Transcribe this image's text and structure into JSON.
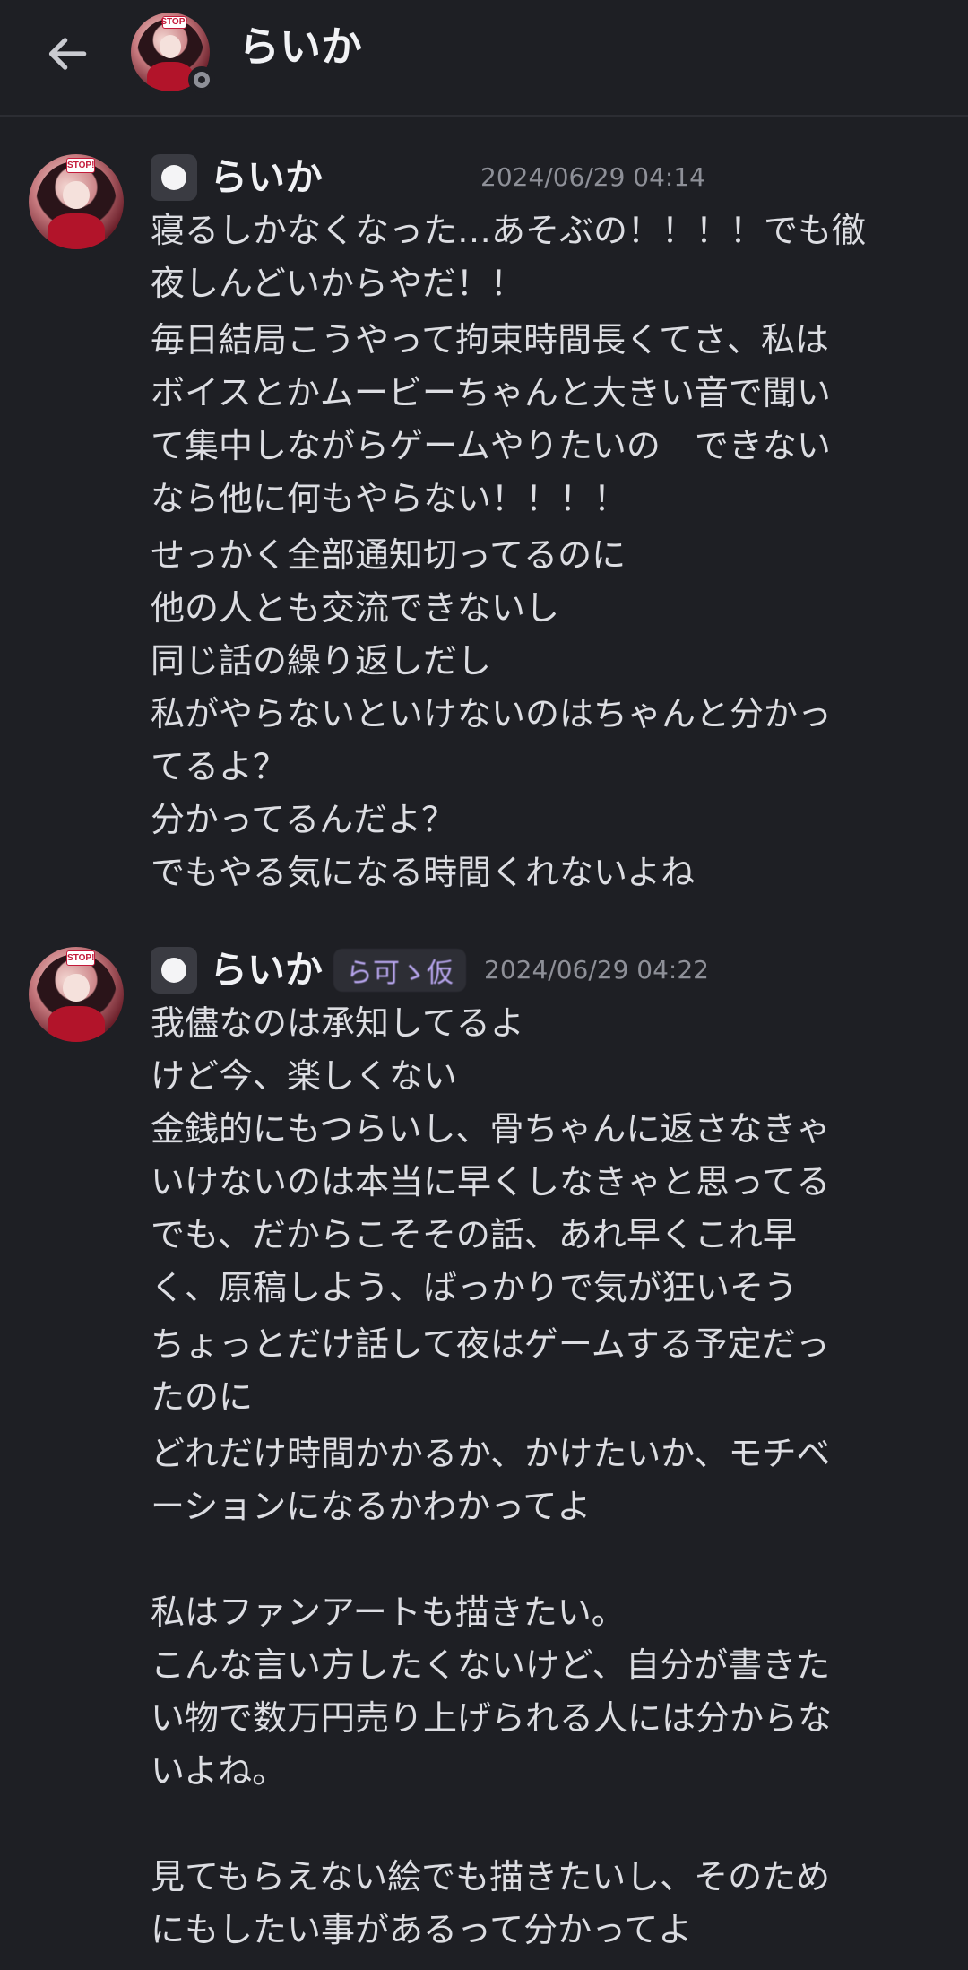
{
  "header": {
    "back_icon": "arrow-left-icon",
    "title": "らいか",
    "avatar_badge_text": "STOP!",
    "status": "idle"
  },
  "messages": [
    {
      "author": "らいか",
      "timestamp": "2024/06/29 04:14",
      "avatar_badge_text": "STOP!",
      "paragraphs": [
        "寝るしかなくなった…あそぶの！！！！でも徹\n夜しんどいからやだ！！",
        "毎日結局こうやって拘束時間長くてさ、私は\nボイスとかムービーちゃんと大きい音で聞い\nて集中しながらゲームやりたいの　できない\nなら他に何もやらない！！！！",
        "せっかく全部通知切ってるのに\n他の人とも交流できないし\n同じ話の繰り返しだし\n私がやらないといけないのはちゃんと分かっ\nてるよ？\n分かってるんだよ？\nでもやる気になる時間くれないよね"
      ]
    },
    {
      "author": "らいか",
      "tag": "ら可ゝ仮",
      "timestamp": "2024/06/29 04:22",
      "avatar_badge_text": "STOP!",
      "paragraphs": [
        "我儘なのは承知してるよ\nけど今、楽しくない\n金銭的にもつらいし、骨ちゃんに返さなきゃ\nいけないのは本当に早くしなきゃと思ってる\nでも、だからこそその話、あれ早くこれ早\nく、原稿しよう、ばっかりで気が狂いそう",
        "ちょっとだけ話して夜はゲームする予定だっ\nたのに",
        "どれだけ時間かかるか、かけたいか、モチベ\nーションになるかわかってよ\n\n私はファンアートも描きたい。\nこんな言い方したくないけど、自分が書きた\nい物で数万円売り上げられる人には分からな\nいよね。\n\n見てもらえない絵でも描きたいし、そのため\nにもしたい事があるって分かってよ"
      ]
    }
  ]
}
